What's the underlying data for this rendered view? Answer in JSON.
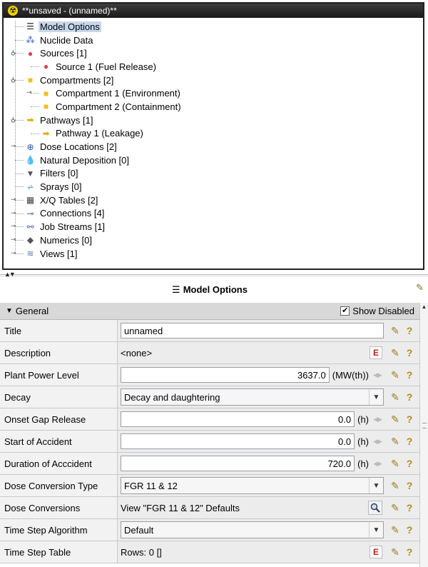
{
  "window": {
    "title": "**unsaved - (unnamed)**"
  },
  "tree": [
    {
      "label": "Model Options",
      "icon": "list-icon",
      "level": 0,
      "toggle": "",
      "selected": true
    },
    {
      "label": "Nuclide Data",
      "icon": "nuclide-icon",
      "level": 0,
      "toggle": ""
    },
    {
      "label": "Sources [1]",
      "icon": "source-icon",
      "level": 0,
      "toggle": "expanded"
    },
    {
      "label": "Source 1 (Fuel Release)",
      "icon": "source-icon",
      "level": 1,
      "toggle": ""
    },
    {
      "label": "Compartments [2]",
      "icon": "compartment-icon",
      "level": 0,
      "toggle": "expanded"
    },
    {
      "label": "Compartment 1 (Environment)",
      "icon": "compartment-icon",
      "level": 1,
      "toggle": "collapsed"
    },
    {
      "label": "Compartment 2 (Containment)",
      "icon": "compartment-icon",
      "level": 1,
      "toggle": ""
    },
    {
      "label": "Pathways [1]",
      "icon": "pathway-icon",
      "level": 0,
      "toggle": "expanded"
    },
    {
      "label": "Pathway 1 (Leakage)",
      "icon": "pathway-icon",
      "level": 1,
      "toggle": ""
    },
    {
      "label": "Dose Locations [2]",
      "icon": "dose-location-icon",
      "level": 0,
      "toggle": "collapsed"
    },
    {
      "label": "Natural Deposition [0]",
      "icon": "deposition-icon",
      "level": 0,
      "toggle": ""
    },
    {
      "label": "Filters [0]",
      "icon": "filter-icon",
      "level": 0,
      "toggle": ""
    },
    {
      "label": "Sprays [0]",
      "icon": "spray-icon",
      "level": 0,
      "toggle": ""
    },
    {
      "label": "X/Q Tables [2]",
      "icon": "table-icon",
      "level": 0,
      "toggle": "collapsed"
    },
    {
      "label": "Connections [4]",
      "icon": "connection-icon",
      "level": 0,
      "toggle": "collapsed"
    },
    {
      "label": "Job Streams [1]",
      "icon": "job-stream-icon",
      "level": 0,
      "toggle": "collapsed"
    },
    {
      "label": "Numerics [0]",
      "icon": "numerics-icon",
      "level": 0,
      "toggle": "collapsed"
    },
    {
      "label": "Views [1]",
      "icon": "views-icon",
      "level": 0,
      "toggle": "collapsed"
    }
  ],
  "props": {
    "title": "Model Options",
    "section": {
      "label": "General",
      "show_disabled_label": "Show Disabled",
      "show_disabled_checked": true
    },
    "rows": [
      {
        "name": "Title",
        "kind": "text",
        "value": "unnamed"
      },
      {
        "name": "Description",
        "kind": "plain-edit",
        "value": "<none>"
      },
      {
        "name": "Plant Power Level",
        "kind": "number",
        "value": "3637.0",
        "unit": "(MW(th))"
      },
      {
        "name": "Decay",
        "kind": "dropdown",
        "value": "Decay and daughtering"
      },
      {
        "name": "Onset Gap Release",
        "kind": "number",
        "value": "0.0",
        "unit": "(h)"
      },
      {
        "name": "Start of Accident",
        "kind": "number",
        "value": "0.0",
        "unit": "(h)"
      },
      {
        "name": "Duration of Acccident",
        "kind": "number",
        "value": "720.0",
        "unit": "(h)"
      },
      {
        "name": "Dose Conversion Type",
        "kind": "dropdown",
        "value": "FGR 11 & 12"
      },
      {
        "name": "Dose Conversions",
        "kind": "plain-search",
        "value": "View \"FGR 11 & 12\" Defaults"
      },
      {
        "name": "Time Step Algorithm",
        "kind": "dropdown",
        "value": "Default"
      },
      {
        "name": "Time Step Table",
        "kind": "plain-edit",
        "value": "Rows: 0 []"
      }
    ]
  },
  "colors": {
    "selection": "#c8d8ec",
    "titlebar": "#2a2a2a",
    "section": "#d8d8d8"
  }
}
